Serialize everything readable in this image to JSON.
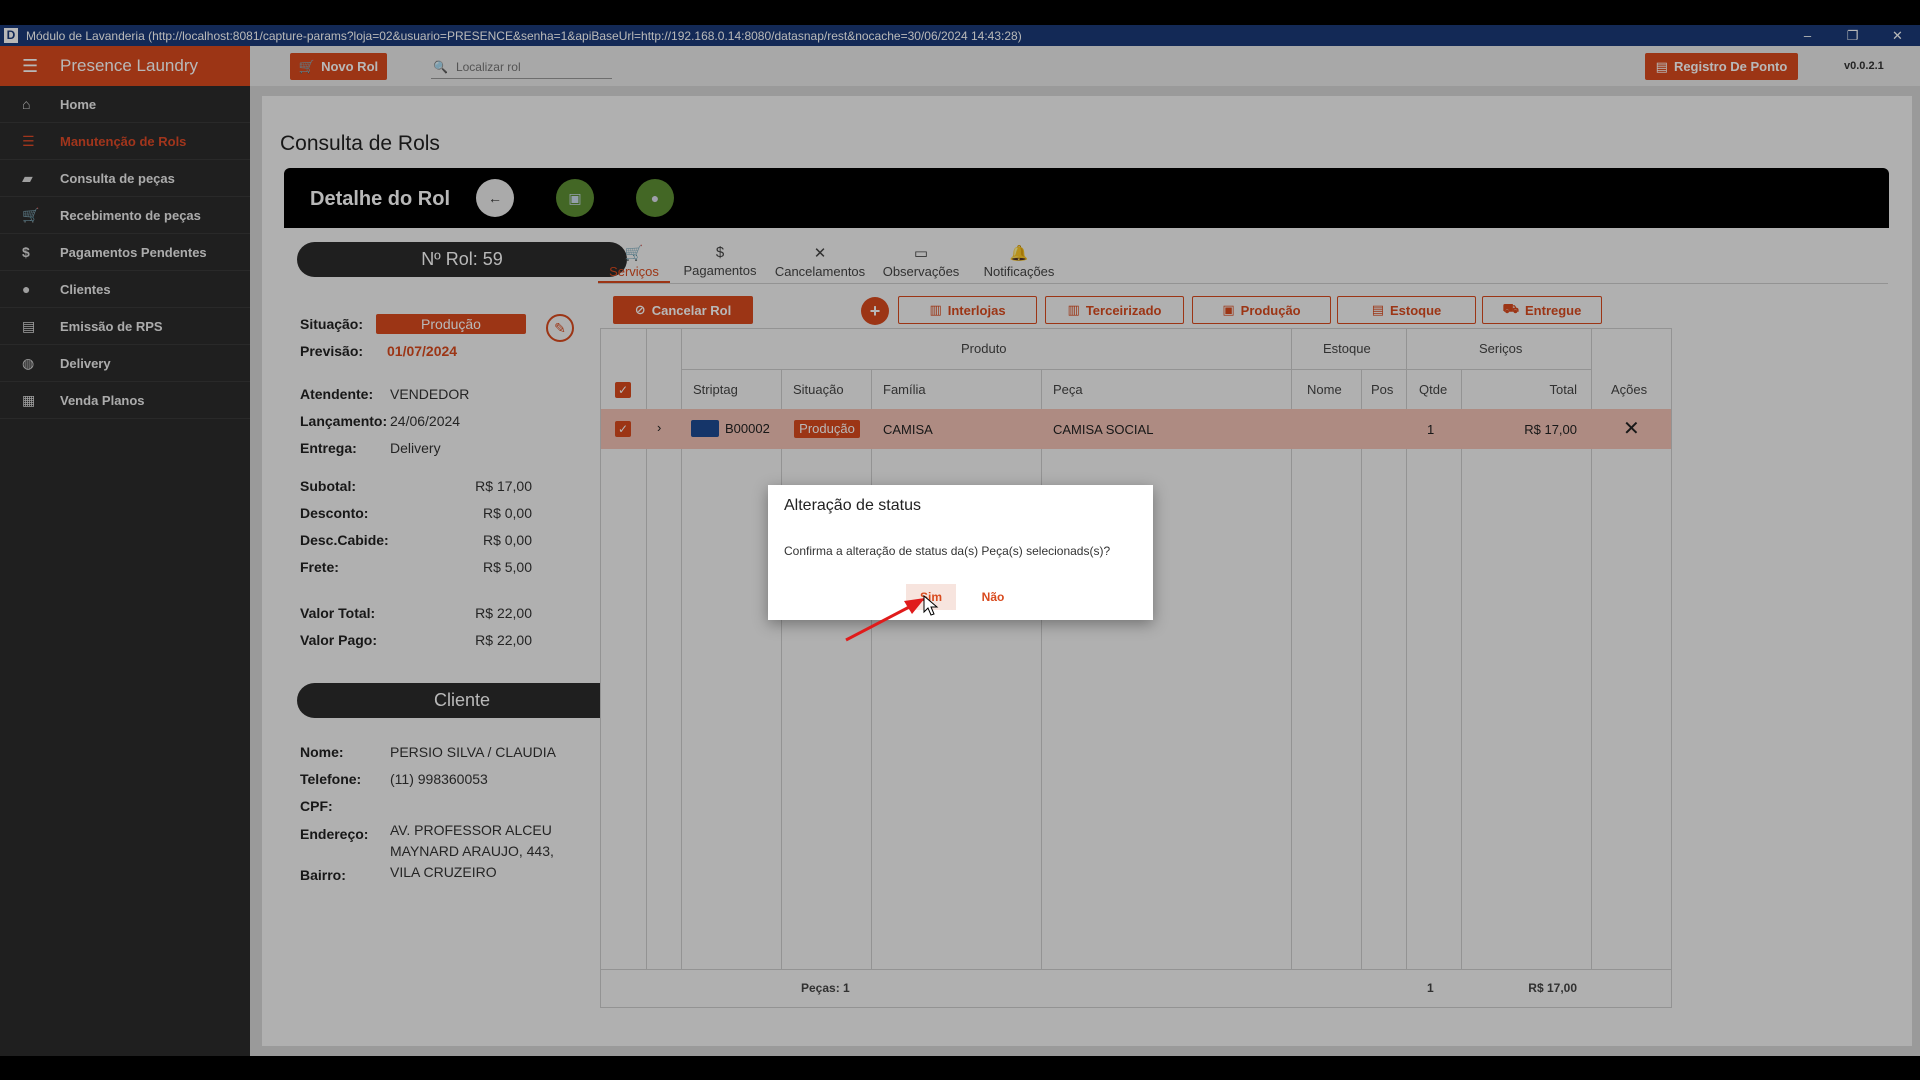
{
  "window": {
    "title": "Módulo de Lavanderia (http://localhost:8081/capture-params?loja=02&usuario=PRESENCE&senha=1&apiBaseUrl=http://192.168.0.14:8080/datasnap/rest&nocache=30/06/2024 14:43:28)",
    "app_letter": "D",
    "minimize": "–",
    "restore": "❐",
    "close": "✕"
  },
  "sidebar": {
    "brand": "Presence Laundry",
    "menu_icon": "hamburger-icon",
    "items": [
      {
        "label": "Home",
        "icon": "home-icon",
        "glyph": "⌂",
        "active": false
      },
      {
        "label": "Manutenção de Rols",
        "icon": "list-edit-icon",
        "glyph": "☰",
        "active": true
      },
      {
        "label": "Consulta de peças",
        "icon": "tag-icon",
        "glyph": "▰",
        "active": false
      },
      {
        "label": "Recebimento de peças",
        "icon": "cart-icon",
        "glyph": "🛒",
        "active": false
      },
      {
        "label": "Pagamentos Pendentes",
        "icon": "dollar-icon",
        "glyph": "$",
        "active": false
      },
      {
        "label": "Clientes",
        "icon": "person-icon",
        "glyph": "●",
        "active": false
      },
      {
        "label": "Emissão de RPS",
        "icon": "document-icon",
        "glyph": "▤",
        "active": false
      },
      {
        "label": "Delivery",
        "icon": "delivery-icon",
        "glyph": "◍",
        "active": false
      },
      {
        "label": "Venda Planos",
        "icon": "plan-icon",
        "glyph": "▦",
        "active": false
      }
    ]
  },
  "topbar": {
    "novo_rol": "Novo Rol",
    "search_placeholder": "Localizar rol",
    "registro": "Registro De Ponto",
    "version": "v0.0.2.1"
  },
  "page": {
    "title": "Consulta de Rols",
    "detail_title": "Detalhe do Rol"
  },
  "rol": {
    "numero": "Nº Rol: 59",
    "situacao_label": "Situação:",
    "situacao": "Produção",
    "previsao_label": "Previsão:",
    "previsao": "01/07/2024",
    "atendente_label": "Atendente:",
    "atendente": "VENDEDOR",
    "lancamento_label": "Lançamento:",
    "lancamento": "24/06/2024",
    "entrega_label": "Entrega:",
    "entrega": "Delivery",
    "subtotal_label": "Subotal:",
    "subtotal": "R$ 17,00",
    "desconto_label": "Desconto:",
    "desconto": "R$ 0,00",
    "desc_cabide_label": "Desc.Cabide:",
    "desc_cabide": "R$ 0,00",
    "frete_label": "Frete:",
    "frete": "R$ 5,00",
    "valor_total_label": "Valor Total:",
    "valor_total": "R$ 22,00",
    "valor_pago_label": "Valor Pago:",
    "valor_pago": "R$ 22,00"
  },
  "cliente": {
    "header": "Cliente",
    "nome_label": "Nome:",
    "nome": "PERSIO SILVA / CLAUDIA",
    "telefone_label": "Telefone:",
    "telefone": "(11) 998360053",
    "cpf_label": "CPF:",
    "cpf": "",
    "endereco_label": "Endereço:",
    "endereco_1": "AV. PROFESSOR ALCEU",
    "endereco_2": "MAYNARD ARAUJO, 443,",
    "bairro_label": "Bairro:",
    "bairro": "VILA CRUZEIRO"
  },
  "tabs": [
    {
      "label": "Serviços",
      "icon": "cart-icon",
      "glyph": "🛒"
    },
    {
      "label": "Pagamentos",
      "icon": "dollar-icon",
      "glyph": "$"
    },
    {
      "label": "Cancelamentos",
      "icon": "close-icon",
      "glyph": "✕"
    },
    {
      "label": "Observações",
      "icon": "comment-icon",
      "glyph": "▭"
    },
    {
      "label": "Notificações",
      "icon": "bell-icon",
      "glyph": "🔔"
    }
  ],
  "actions": {
    "cancelar_rol": "Cancelar Rol",
    "add": "+",
    "interlojas": "Interlojas",
    "terceirizado": "Terceirizado",
    "producao": "Produção",
    "estoque": "Estoque",
    "entregue": "Entregue"
  },
  "table": {
    "group_produto": "Produto",
    "group_estoque": "Estoque",
    "group_servicos": "Seriços",
    "col_striptag": "Striptag",
    "col_situacao": "Situação",
    "col_familia": "Família",
    "col_peca": "Peça",
    "col_nome": "Nome",
    "col_pos": "Pos",
    "col_qtde": "Qtde",
    "col_total": "Total",
    "col_acoes": "Ações",
    "row": {
      "striptag": "B00002",
      "situacao": "Produção",
      "familia": "CAMISA",
      "peca": "CAMISA SOCIAL",
      "nome": "",
      "pos": "",
      "qtde": "1",
      "total": "R$ 17,00"
    },
    "footer_pecas": "Peças: 1",
    "footer_qtde": "1",
    "footer_total": "R$ 17,00"
  },
  "dialog": {
    "title": "Alteração de status",
    "message": "Confirma a alteração de status da(s) Peça(s) selecionads(s)?",
    "yes": "Sim",
    "no": "Não"
  },
  "colors": {
    "accent": "#d84a1e",
    "sidebar_bg": "#2b2b2b",
    "titlebar_bg": "#1b3a78",
    "row_highlight": "#f1c1b4",
    "arrow": "#e01b1b"
  }
}
